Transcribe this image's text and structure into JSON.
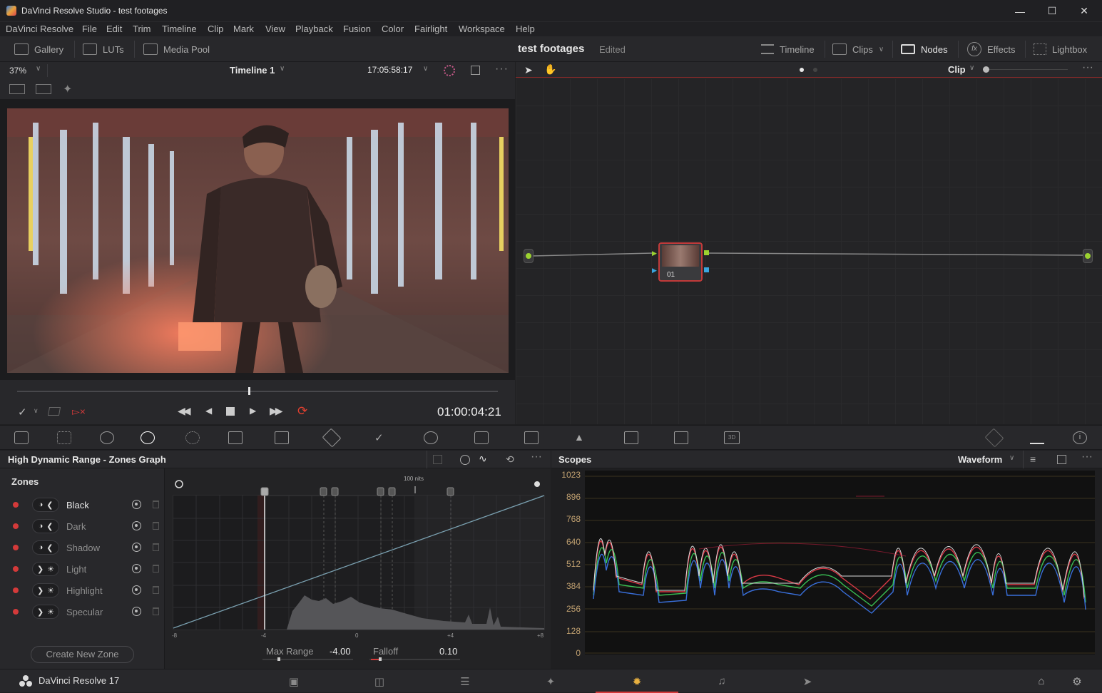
{
  "window": {
    "title": "DaVinci Resolve Studio - test footages"
  },
  "menu": [
    "DaVinci Resolve",
    "File",
    "Edit",
    "Trim",
    "Timeline",
    "Clip",
    "Mark",
    "View",
    "Playback",
    "Fusion",
    "Color",
    "Fairlight",
    "Workspace",
    "Help"
  ],
  "toolbar": {
    "gallery": "Gallery",
    "luts": "LUTs",
    "media_pool": "Media Pool",
    "project_name": "test footages",
    "project_status": "Edited",
    "timeline": "Timeline",
    "clips": "Clips",
    "nodes": "Nodes",
    "effects": "Effects",
    "lightbox": "Lightbox"
  },
  "viewer": {
    "zoom": "37%",
    "timeline_name": "Timeline 1",
    "source_timecode": "17:05:58:17",
    "playhead_timecode": "01:00:04:21",
    "scrub_position": 0.48
  },
  "node_editor": {
    "mode": "Clip",
    "node_label": "01"
  },
  "hdr": {
    "panel_title": "High Dynamic Range - Zones Graph",
    "zones_header": "Zones",
    "zones": [
      {
        "name": "Black",
        "type": "dark"
      },
      {
        "name": "Dark",
        "type": "dark"
      },
      {
        "name": "Shadow",
        "type": "dark"
      },
      {
        "name": "Light",
        "type": "light"
      },
      {
        "name": "Highlight",
        "type": "light"
      },
      {
        "name": "Specular",
        "type": "light"
      }
    ],
    "create_zone": "Create New Zone",
    "nits_label": "100 nits",
    "x_ticks": [
      "-8",
      "-4",
      "0",
      "+4",
      "+8"
    ],
    "max_range_label": "Max Range",
    "max_range_value": "-4.00",
    "falloff_label": "Falloff",
    "falloff_value": "0.10"
  },
  "scopes": {
    "title": "Scopes",
    "mode": "Waveform",
    "y_ticks": [
      "1023",
      "896",
      "768",
      "640",
      "512",
      "384",
      "256",
      "128",
      "0"
    ]
  },
  "footer": {
    "app_name": "DaVinci Resolve 17"
  },
  "colors": {
    "accent_red": "#d43a3a",
    "node_border": "#c23a3a",
    "scale_label": "#c0a070"
  }
}
